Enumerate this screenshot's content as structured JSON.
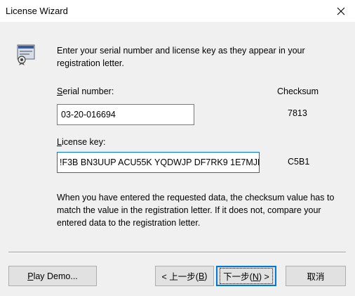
{
  "window": {
    "title": "License Wizard",
    "close_icon": "close-icon",
    "dialog_icon": "license-wizard-icon"
  },
  "intro": {
    "text": "Enter your serial number and license key as they appear in your registration letter."
  },
  "serial": {
    "label_prefix": "",
    "label_accel": "S",
    "label_rest": "erial number:",
    "value": "03-20-016694",
    "checksum": "7813"
  },
  "checksum_header": "Checksum",
  "license": {
    "label_prefix": "",
    "label_accel": "L",
    "label_rest": "icense key:",
    "value": "!F3B BN3UUP ACU55K YQDWJP DF7RK9 1E7MJP",
    "checksum": "C5B1"
  },
  "info": {
    "text": "When you have entered the requested data, the checksum value has to match the value in the registration letter.  If it does not, compare your entered data to the registration letter."
  },
  "buttons": {
    "play_demo": {
      "accel": "P",
      "rest": "lay Demo..."
    },
    "back": {
      "pre": "< 上一步(",
      "accel": "B",
      "post": ")"
    },
    "next": {
      "pre": "下一步(",
      "accel": "N",
      "post": ") >"
    },
    "cancel": "取消"
  },
  "colors": {
    "window_bg": "#f0f0f0",
    "focus_border": "#0078d7",
    "button_bg": "#e1e1e1"
  }
}
